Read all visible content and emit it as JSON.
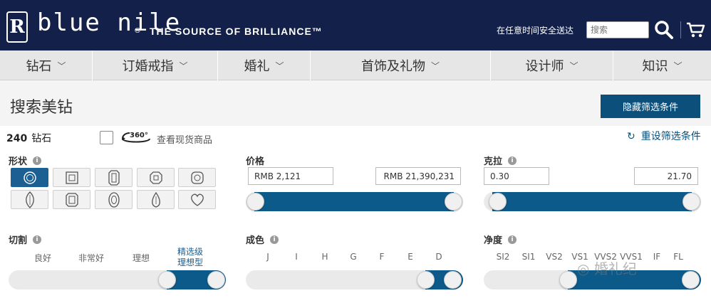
{
  "header": {
    "logo_mark": "R",
    "brand": "blue nile",
    "brand_reg": "®",
    "tagline": "THE SOURCE OF BRILLIANCE™",
    "shipping_text": "在任意时间安全送达",
    "search_placeholder": "搜索",
    "colors": {
      "background": "#13214a",
      "text": "#ffffff"
    }
  },
  "nav": {
    "items": [
      {
        "label": "钻石",
        "icon": "chevron-down"
      },
      {
        "label": "订婚戒指",
        "icon": "chevron-down"
      },
      {
        "label": "婚礼",
        "icon": "chevron-down"
      },
      {
        "label": "首饰及礼物",
        "icon": "chevron-down"
      },
      {
        "label": "设计师",
        "icon": "chevron-down"
      },
      {
        "label": "知识",
        "icon": "chevron-down"
      }
    ]
  },
  "page": {
    "title": "搜索美钻",
    "hide_filters_label": "隐藏筛选条件",
    "result_count": "240",
    "result_unit": "钻石",
    "instock_label": "查看现货商品",
    "instock_checked": false,
    "badge_360": "360°",
    "reset_label": "重设筛选条件",
    "accent_color": "#0c5a8a"
  },
  "filters": {
    "shape": {
      "label": "形状",
      "icon_names": [
        "round-icon",
        "princess-icon",
        "emerald-icon",
        "asscher-icon",
        "cushion-icon",
        "marquise-icon",
        "radiant-icon",
        "oval-icon",
        "pear-icon",
        "heart-icon"
      ],
      "selected": "round-icon"
    },
    "price": {
      "label": "价格",
      "min": "RMB 2,121",
      "max": "RMB 21,390,231",
      "range_fraction": [
        0,
        1
      ]
    },
    "carat": {
      "label": "克拉",
      "min": "0.30",
      "max": "21.70",
      "range_fraction": [
        0,
        1
      ]
    },
    "cut": {
      "label": "切割",
      "options": [
        "良好",
        "非常好",
        "理想"
      ],
      "selected_option_line1": "精选级",
      "selected_option_line2": "理想型",
      "selected_range": [
        "精选级理想型",
        "精选级理想型"
      ]
    },
    "color": {
      "label": "成色",
      "options": [
        "J",
        "I",
        "H",
        "G",
        "F",
        "E",
        "D"
      ],
      "selected_range": [
        "E",
        "D"
      ]
    },
    "clarity": {
      "label": "净度",
      "options": [
        "SI2",
        "SI1",
        "VS2",
        "VS1",
        "VVS2",
        "VVS1",
        "IF",
        "FL"
      ],
      "selected_range": [
        "VS2",
        "FL"
      ]
    }
  },
  "watermark": "婚礼纪"
}
